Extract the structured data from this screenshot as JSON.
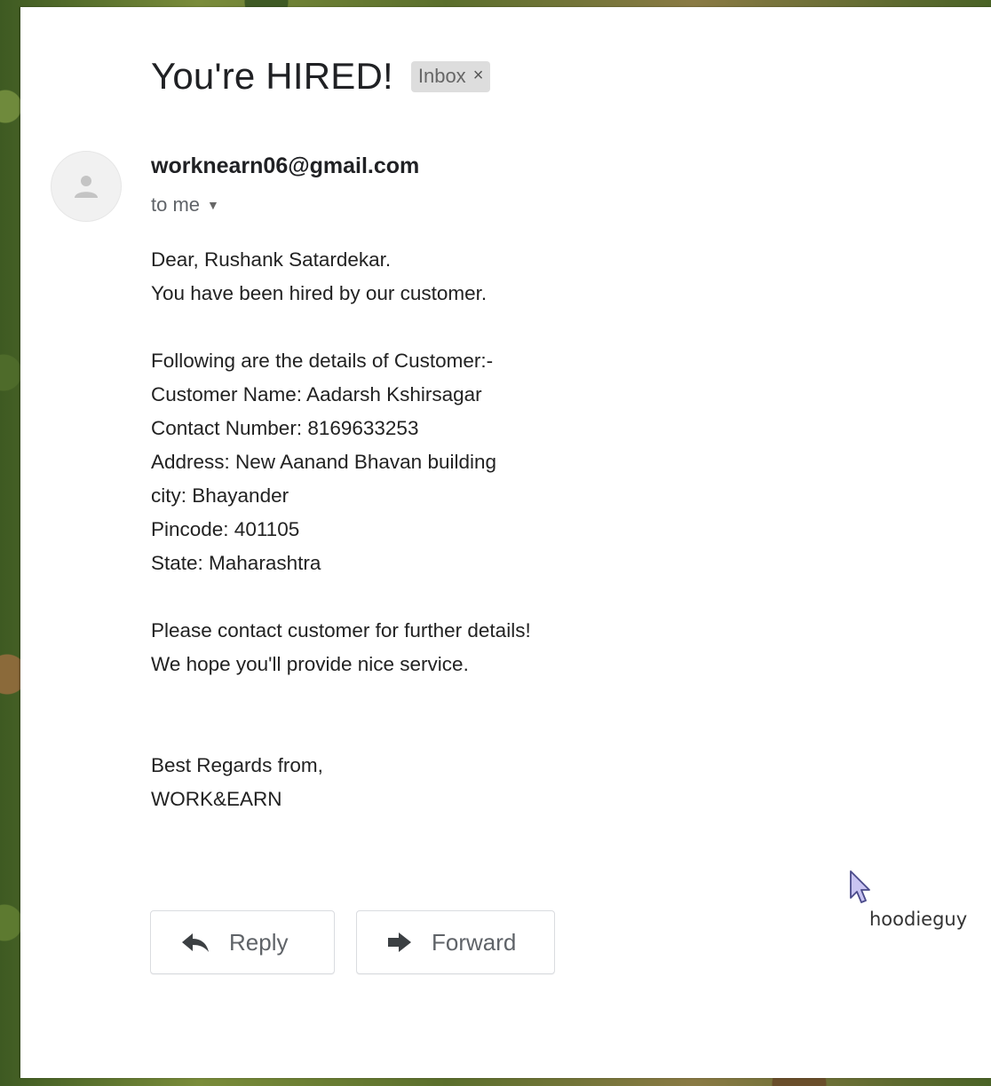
{
  "email": {
    "subject": "You're HIRED!",
    "label": "Inbox",
    "label_close": "×",
    "sender": "worknearn06@gmail.com",
    "recipient": "to me",
    "body_lines": [
      "Dear, Rushank Satardekar.",
      "You have been hired by our customer.",
      "",
      "Following are the details of Customer:-",
      "Customer Name: Aadarsh Kshirsagar",
      "Contact Number: 8169633253",
      "Address: New Aanand Bhavan building",
      "city: Bhayander",
      "Pincode: 401105",
      "State: Maharashtra",
      "",
      "Please contact customer for further details!",
      "We hope you'll provide nice service.",
      "",
      "",
      "Best Regards from,",
      "WORK&EARN"
    ]
  },
  "actions": {
    "reply_label": "Reply",
    "forward_label": "Forward"
  },
  "cursor": {
    "label": "hoodieguy"
  },
  "icons": {
    "avatar": "person-icon",
    "recipient_caret": "caret-down-icon",
    "reply": "reply-icon",
    "forward": "forward-icon",
    "cursor": "mouse-pointer-icon"
  }
}
